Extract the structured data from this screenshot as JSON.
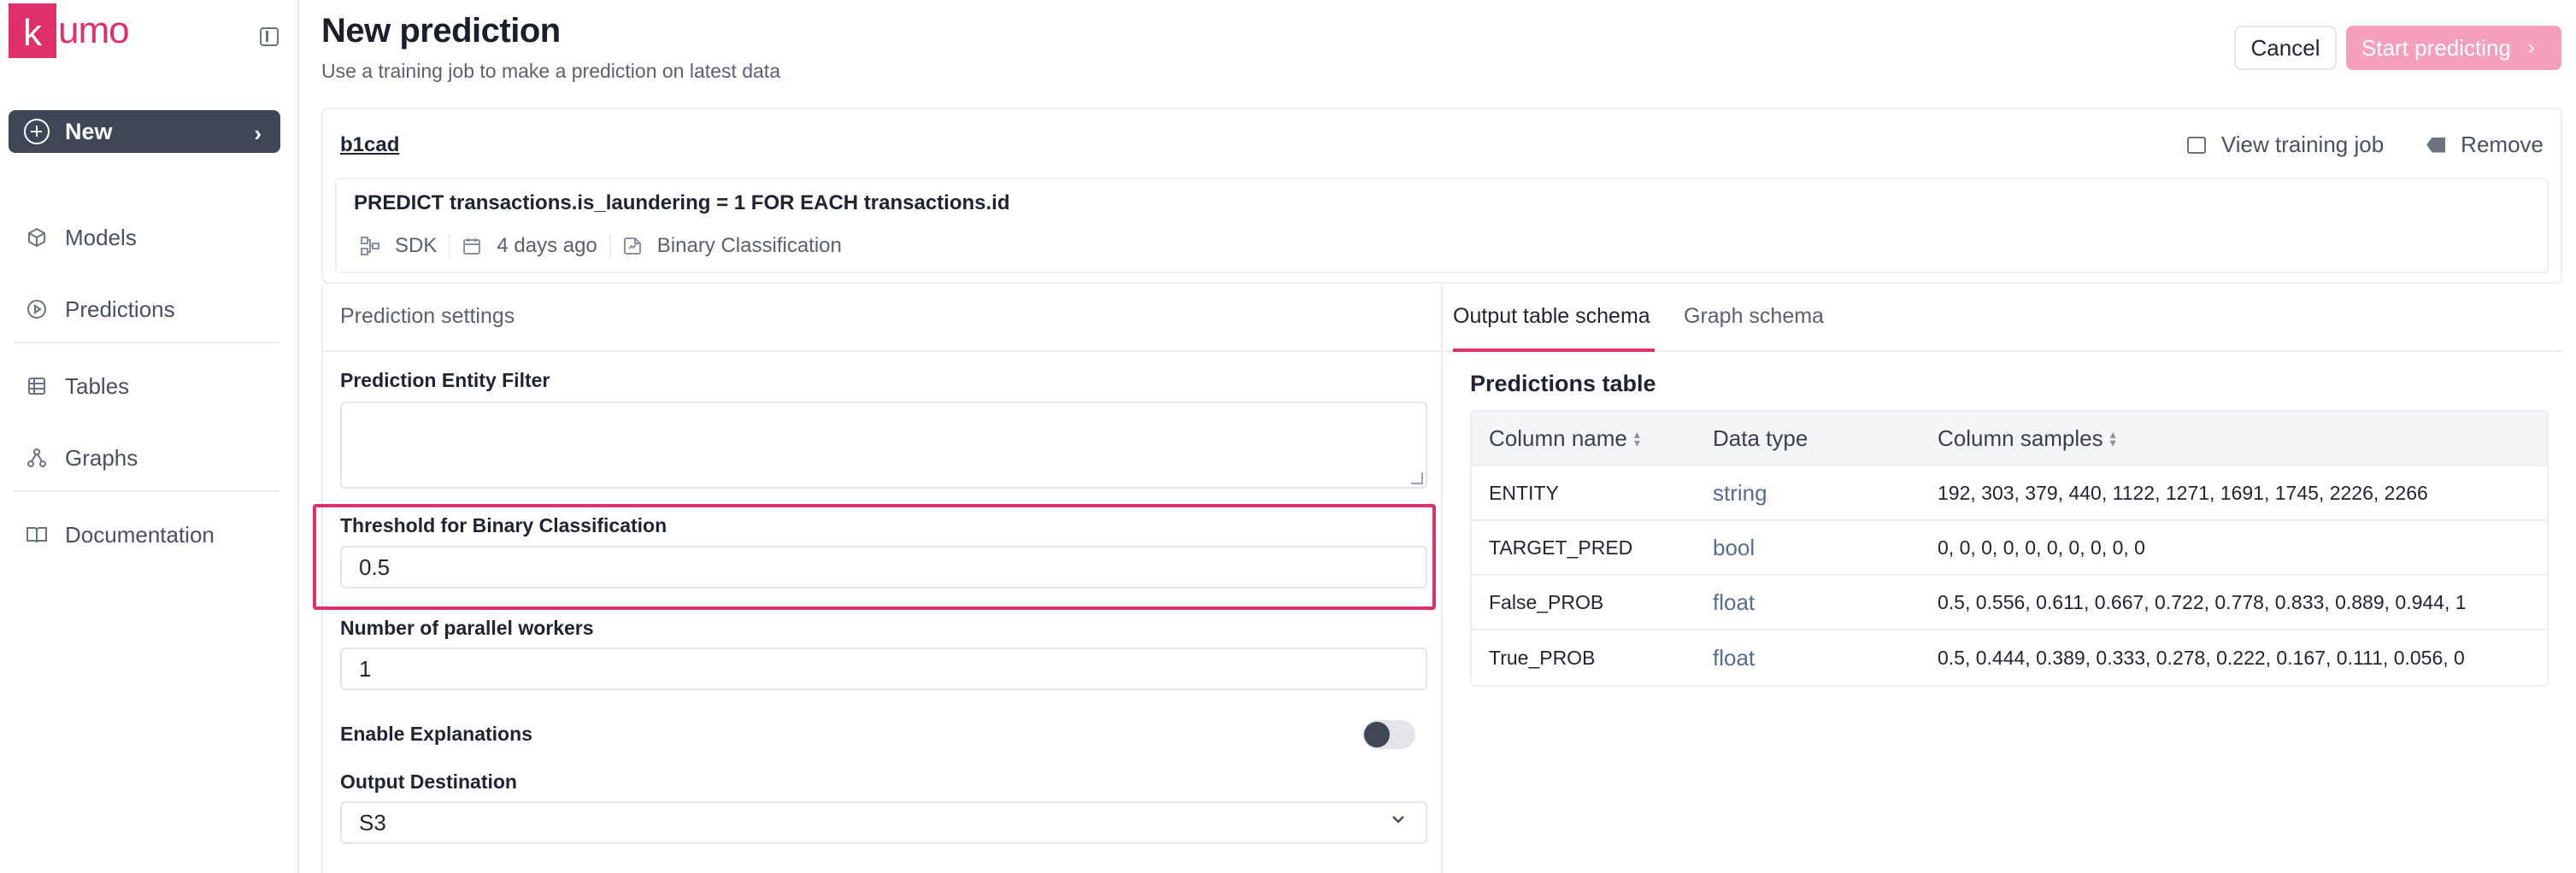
{
  "app": {
    "logo_k": "k",
    "logo_rest": "umo",
    "brand_color": "#e0306c"
  },
  "sidebar": {
    "new_label": "New",
    "items": [
      {
        "label": "Models",
        "icon": "cube-icon"
      },
      {
        "label": "Predictions",
        "icon": "play-circle-icon"
      },
      {
        "label": "Tables",
        "icon": "table-icon"
      },
      {
        "label": "Graphs",
        "icon": "graph-icon"
      },
      {
        "label": "Documentation",
        "icon": "book-icon"
      }
    ]
  },
  "header": {
    "title": "New prediction",
    "subtitle": "Use a training job to make a prediction on latest data",
    "cancel_label": "Cancel",
    "start_label": "Start predicting"
  },
  "job": {
    "id": "b1cad",
    "view_label": "View training job",
    "remove_label": "Remove",
    "query": "PREDICT transactions.is_laundering = 1 FOR EACH transactions.id",
    "source": "SDK",
    "created": "4 days ago",
    "task_type": "Binary Classification"
  },
  "settings": {
    "panel_title": "Prediction settings",
    "filter_label": "Prediction Entity Filter",
    "filter_value": "",
    "threshold_label": "Threshold for Binary Classification",
    "threshold_value": "0.5",
    "workers_label": "Number of parallel workers",
    "workers_value": "1",
    "explanations_label": "Enable Explanations",
    "explanations_enabled": false,
    "destination_label": "Output Destination",
    "destination_value": "S3"
  },
  "schema": {
    "tabs": [
      "Output table schema",
      "Graph schema"
    ],
    "active_tab": "Output table schema",
    "table_title": "Predictions table",
    "columns": [
      "Column name",
      "Data type",
      "Column samples"
    ],
    "rows": [
      {
        "name": "ENTITY",
        "type": "string",
        "samples": "192, 303, 379, 440, 1122, 1271, 1691, 1745, 2226, 2266"
      },
      {
        "name": "TARGET_PRED",
        "type": "bool",
        "samples": "0, 0, 0, 0, 0, 0, 0, 0, 0, 0"
      },
      {
        "name": "False_PROB",
        "type": "float",
        "samples": "0.5, 0.556, 0.611, 0.667, 0.722, 0.778, 0.833, 0.889, 0.944, 1"
      },
      {
        "name": "True_PROB",
        "type": "float",
        "samples": "0.5, 0.444, 0.389, 0.333, 0.278, 0.222, 0.167, 0.111, 0.056, 0"
      }
    ]
  }
}
